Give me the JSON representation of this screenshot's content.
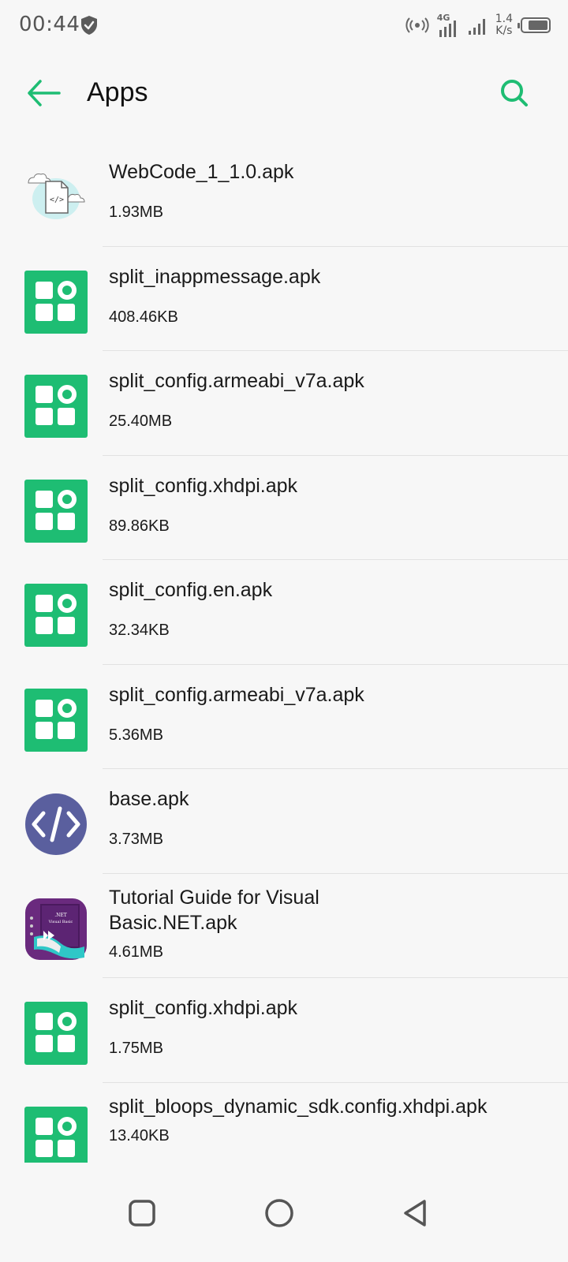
{
  "status_bar": {
    "time": "00:44",
    "network": "4G",
    "speed_value": "1.4",
    "speed_unit": "K/s"
  },
  "app_bar": {
    "title": "Apps"
  },
  "colors": {
    "accent": "#1ebd73",
    "code_icon": "#5a5f9e"
  },
  "files": [
    {
      "name": "WebCode_1_1.0.apk",
      "size": "1.93MB",
      "icon": "webcode-file-icon"
    },
    {
      "name": "split_inappmessage.apk",
      "size": "408.46KB",
      "icon": "app-grid-icon"
    },
    {
      "name": "split_config.armeabi_v7a.apk",
      "size": "25.40MB",
      "icon": "app-grid-icon"
    },
    {
      "name": "split_config.xhdpi.apk",
      "size": "89.86KB",
      "icon": "app-grid-icon"
    },
    {
      "name": "split_config.en.apk",
      "size": "32.34KB",
      "icon": "app-grid-icon"
    },
    {
      "name": "split_config.armeabi_v7a.apk",
      "size": "5.36MB",
      "icon": "app-grid-icon"
    },
    {
      "name": "base.apk",
      "size": "3.73MB",
      "icon": "code-brackets-icon"
    },
    {
      "name": "Tutorial Guide for Visual Basic.NET.apk",
      "size": "4.61MB",
      "icon": "visual-basic-book-icon"
    },
    {
      "name": "split_config.xhdpi.apk",
      "size": "1.75MB",
      "icon": "app-grid-icon"
    },
    {
      "name": "split_bloops_dynamic_sdk.config.xhdpi.apk",
      "size": "13.40KB",
      "icon": "app-grid-icon"
    }
  ]
}
